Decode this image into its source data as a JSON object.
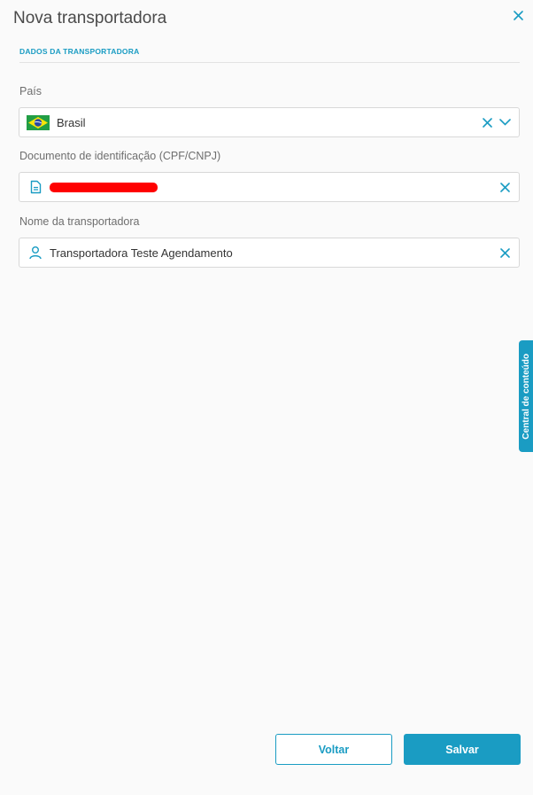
{
  "header": {
    "title": "Nova transportadora"
  },
  "section": {
    "title": "DADOS DA TRANSPORTADORA"
  },
  "fields": {
    "country": {
      "label": "País",
      "value": "Brasil"
    },
    "document": {
      "label": "Documento de identificação (CPF/CNPJ)",
      "value": ""
    },
    "name": {
      "label": "Nome da transportadora",
      "value": "Transportadora Teste Agendamento"
    }
  },
  "side_tab": {
    "label": "Central de conteúdo"
  },
  "buttons": {
    "back": "Voltar",
    "save": "Salvar"
  },
  "colors": {
    "accent": "#1a9cc3",
    "redaction": "#ff0000"
  },
  "icons": {
    "close": "close-icon",
    "clear": "clear-icon",
    "dropdown": "chevron-down-icon",
    "document": "document-icon",
    "user": "user-icon",
    "flag": "brazil-flag-icon"
  }
}
